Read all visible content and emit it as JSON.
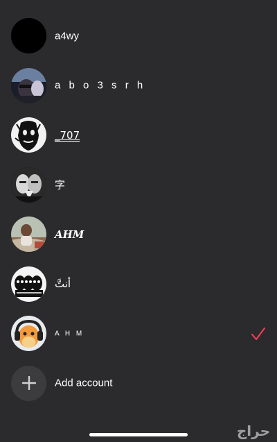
{
  "accounts": [
    {
      "name": "a4wy",
      "icon": "black-avatar",
      "selected": false
    },
    {
      "name": "a b o 3 s r h",
      "icon": "photo-avatar",
      "selected": false
    },
    {
      "name": "_707",
      "icon": "photo-avatar",
      "selected": false
    },
    {
      "name": "字",
      "icon": "photo-avatar",
      "selected": false
    },
    {
      "name": "AHM",
      "icon": "photo-avatar",
      "selected": false
    },
    {
      "name": "أنتَّ",
      "icon": "photo-avatar",
      "selected": false
    },
    {
      "name": "A H M",
      "icon": "charmander-avatar",
      "selected": true
    }
  ],
  "add_account": {
    "label": "Add account",
    "icon": "plus-icon"
  },
  "watermark": "حراج",
  "colors": {
    "background": "#2b2b2d",
    "check": "#ff3b5c",
    "add_circle": "#3c3c3e"
  }
}
